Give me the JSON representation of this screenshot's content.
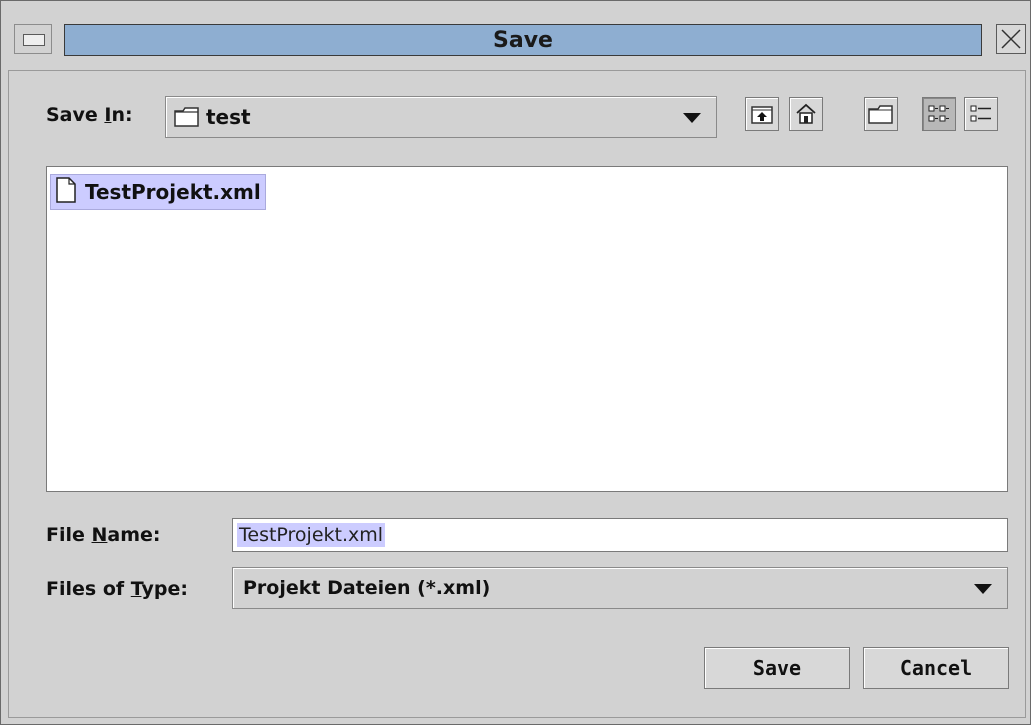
{
  "window": {
    "title": "Save"
  },
  "save_in": {
    "label_prefix": "Save ",
    "label_mnemonic": "I",
    "label_suffix": "n:",
    "current_folder": "test"
  },
  "toolbar": {
    "buttons": [
      {
        "icon": "up-folder-icon"
      },
      {
        "icon": "home-icon"
      },
      {
        "icon": "new-folder-icon"
      },
      {
        "icon": "list-view-icon",
        "active": true
      },
      {
        "icon": "details-view-icon"
      }
    ]
  },
  "files": [
    {
      "name": "TestProjekt.xml",
      "selected": true,
      "icon": "file-icon"
    }
  ],
  "file_name": {
    "label_prefix": "File ",
    "label_mnemonic": "N",
    "label_suffix": "ame:",
    "value": "TestProjekt.xml"
  },
  "file_type": {
    "label_prefix": "Files of ",
    "label_mnemonic": "T",
    "label_suffix": "ype:",
    "selected": "Projekt Dateien (*.xml)"
  },
  "buttons": {
    "save_label": "Save",
    "cancel_label": "Cancel"
  },
  "colors": {
    "title_bar": "#8eaed1",
    "selection": "#ccccff",
    "dialog_bg": "#d2d2d2"
  }
}
